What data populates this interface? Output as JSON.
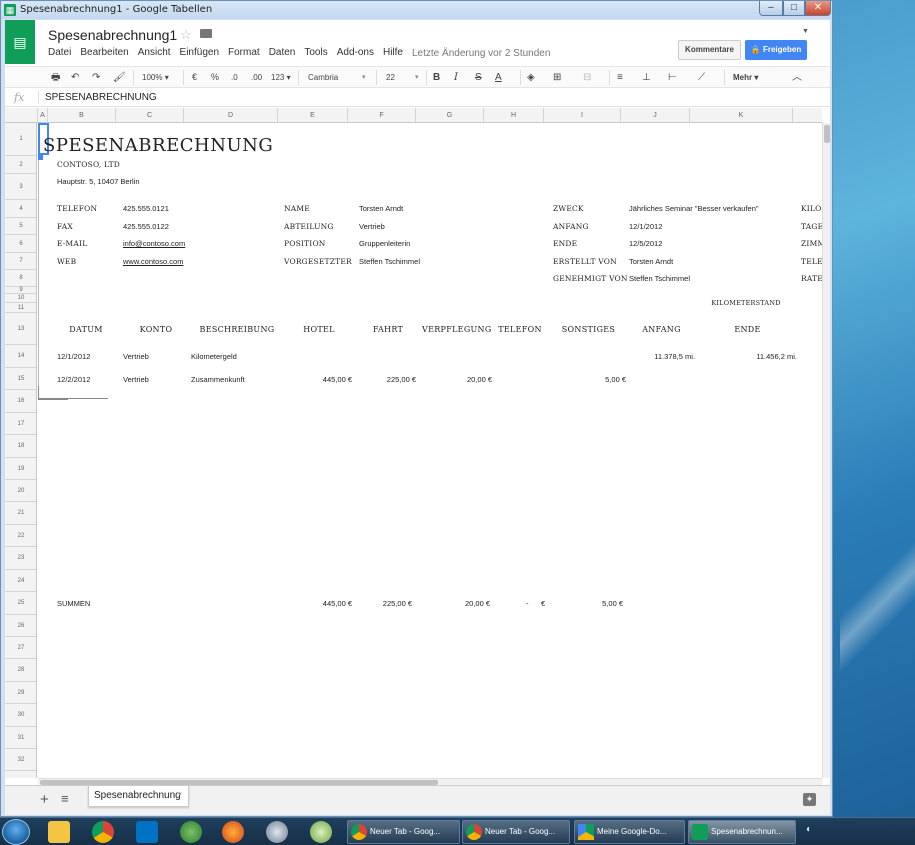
{
  "window": {
    "title": "Spesenabrechnung1 - Google Tabellen",
    "controls": {
      "minimize": "–",
      "maximize": "□",
      "close": "✕"
    }
  },
  "app": {
    "doc_title": "Spesenabrechnung1",
    "last_edit": "Letzte Änderung vor 2 Stunden",
    "menu": [
      "Datei",
      "Bearbeiten",
      "Ansicht",
      "Einfügen",
      "Format",
      "Daten",
      "Tools",
      "Add-ons",
      "Hilfe"
    ],
    "buttons": {
      "comments": "Kommentare",
      "share": "Freigeben"
    }
  },
  "toolbar": {
    "zoom": "100%",
    "currency": "€",
    "percent": "%",
    "dec_less": ".0",
    "dec_more": ".00",
    "more_formats": "123",
    "font": "Cambria",
    "size": "22",
    "more": "Mehr"
  },
  "formula_bar": {
    "label": "fx",
    "value": "SPESENABRECHNUNG"
  },
  "columns": [
    "A",
    "B",
    "C",
    "D",
    "E",
    "F",
    "G",
    "H",
    "I",
    "J",
    "K"
  ],
  "rows": [
    "1",
    "2",
    "3",
    "4",
    "5",
    "6",
    "7",
    "8",
    "9",
    "10",
    "11",
    "13",
    "14",
    "15",
    "16",
    "17",
    "18",
    "19",
    "20",
    "21",
    "22",
    "23",
    "24",
    "25",
    "26",
    "27",
    "28",
    "29",
    "30",
    "31",
    "32"
  ],
  "sheet": {
    "title": "SPESENABRECHNUNG",
    "company": "CONTOSO, LTD",
    "address": "Hauptstr. 5, 10407 Berlin",
    "contact": [
      {
        "label": "TELEFON",
        "value": "425.555.0121"
      },
      {
        "label": "FAX",
        "value": "425.555.0122"
      },
      {
        "label": "E-MAIL",
        "value": "info@contoso.com"
      },
      {
        "label": "WEB",
        "value": "www.contoso.com"
      }
    ],
    "person": [
      {
        "label": "NAME",
        "value": "Torsten Arndt"
      },
      {
        "label": "ABTEILUNG",
        "value": "Vertrieb"
      },
      {
        "label": "POSITION",
        "value": "Gruppenleiterin"
      },
      {
        "label": "VORGESETZTER",
        "value": "Steffen Tschimmel"
      }
    ],
    "trip": [
      {
        "label": "ZWECK",
        "value": "Jährliches Seminar \"Besser verkaufen\""
      },
      {
        "label": "ANFANG",
        "value": "12/1/2012"
      },
      {
        "label": "ENDE",
        "value": "12/5/2012"
      },
      {
        "label": "ERSTELLT VON",
        "value": "Torsten Arndt"
      },
      {
        "label": "GENEHMIGT VON",
        "value": "Steffen Tschimmel"
      }
    ],
    "rates": [
      "KILOM",
      "TAGES",
      "ZIMM",
      "TELEI",
      "RATE"
    ],
    "km_header": "KILOMETERSTAND",
    "table_headers": [
      "DATUM",
      "KONTO",
      "BESCHREIBUNG",
      "HOTEL",
      "FAHRT",
      "VERPFLEGUNG",
      "TELEFON",
      "SONSTIGES",
      "ANFANG",
      "ENDE"
    ],
    "entries": [
      {
        "date": "12/1/2012",
        "account": "Vertrieb",
        "desc": "Kilometergeld",
        "hotel": "",
        "travel": "",
        "meals": "",
        "phone": "",
        "other": "",
        "km_start": "11.378,5 mi.",
        "km_end": "11.456,2 mi."
      },
      {
        "date": "12/2/2012",
        "account": "Vertrieb",
        "desc": "Zusammenkunft",
        "hotel": "445,00 €",
        "travel": "225,00 €",
        "meals": "20,00 €",
        "phone": "",
        "other": "5,00 €",
        "km_start": "",
        "km_end": ""
      }
    ],
    "totals": {
      "label": "SUMMEN",
      "hotel": "445,00 €",
      "travel": "225,00 €",
      "meals": "20,00 €",
      "phone_dash": "-",
      "phone_cur": "€",
      "other": "5,00 €"
    }
  },
  "sheet_tab": "Spesenabrechnung",
  "taskbar": {
    "tasks": [
      "Neuer Tab - Goog...",
      "Neuer Tab - Goog...",
      "Meine Google-Do...",
      "Spesenabrechnun..."
    ]
  }
}
